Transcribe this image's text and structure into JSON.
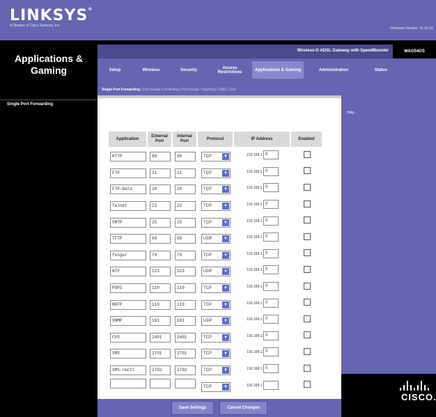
{
  "brand": {
    "logo_text": "LINKSYS",
    "logo_mark": "®",
    "logo_sub": "A Division of Cisco Systems, Inc.",
    "firmware": "Firmware Version: V1.01.00",
    "footer_logo": "CISCO."
  },
  "section_title": "Applications & Gaming",
  "product_name": "Wireless-G ADSL Gateway with SpeedBooster",
  "model": "WAG54GS",
  "tabs": [
    "Setup",
    "Wireless",
    "Security",
    "Access Restrictions",
    "Applications & Gaming",
    "Administration",
    "Status"
  ],
  "active_tab": "Applications & Gaming",
  "subtabs": [
    "Single Port Forwarding",
    "Port Range Forwarding",
    "Port Range Triggering",
    "DMZ",
    "QoS"
  ],
  "active_subtab": "Single Port Forwarding",
  "left_label": "Single Port Forwarding",
  "help_label": "Help...",
  "table": {
    "headers": [
      "Application",
      "External Port",
      "Internal Port",
      "Protocol",
      "IP Address",
      "Enabled"
    ],
    "ip_prefix": "192.168.1.",
    "rows": [
      {
        "app": "HTTP",
        "ext": "80",
        "int": "80",
        "proto": "TCP",
        "ip": "0",
        "enabled": false
      },
      {
        "app": "FTP",
        "ext": "21",
        "int": "21",
        "proto": "TCP",
        "ip": "0",
        "enabled": false
      },
      {
        "app": "FTP-Data",
        "ext": "20",
        "int": "20",
        "proto": "TCP",
        "ip": "0",
        "enabled": false
      },
      {
        "app": "Telnet",
        "ext": "23",
        "int": "23",
        "proto": "TCP",
        "ip": "0",
        "enabled": false
      },
      {
        "app": "SMTP",
        "ext": "25",
        "int": "25",
        "proto": "TCP",
        "ip": "0",
        "enabled": false
      },
      {
        "app": "TFTP",
        "ext": "69",
        "int": "69",
        "proto": "UDP",
        "ip": "0",
        "enabled": false
      },
      {
        "app": "finger",
        "ext": "79",
        "int": "79",
        "proto": "TCP",
        "ip": "0",
        "enabled": false
      },
      {
        "app": "NTP",
        "ext": "123",
        "int": "123",
        "proto": "UDP",
        "ip": "0",
        "enabled": false
      },
      {
        "app": "POP3",
        "ext": "110",
        "int": "110",
        "proto": "TCP",
        "ip": "0",
        "enabled": false
      },
      {
        "app": "NNTP",
        "ext": "119",
        "int": "119",
        "proto": "TCP",
        "ip": "0",
        "enabled": false
      },
      {
        "app": "SNMP",
        "ext": "161",
        "int": "161",
        "proto": "UDP",
        "ip": "0",
        "enabled": false
      },
      {
        "app": "CVS",
        "ext": "2401",
        "int": "2401",
        "proto": "TCP",
        "ip": "0",
        "enabled": false
      },
      {
        "app": "SMS",
        "ext": "2701",
        "int": "2701",
        "proto": "TCP",
        "ip": "0",
        "enabled": false
      },
      {
        "app": "SMS-rmctl",
        "ext": "2702",
        "int": "2702",
        "proto": "TCP",
        "ip": "0",
        "enabled": false
      },
      {
        "app": "",
        "ext": "",
        "int": "",
        "proto": "TCP",
        "ip": "",
        "enabled": false
      }
    ]
  },
  "buttons": {
    "save": "Save Settings",
    "cancel": "Cancel Changes"
  },
  "colors": {
    "brand_purple": "#6764b1",
    "dark": "#000000",
    "dropdown_arrow": "#5d6fc6"
  }
}
